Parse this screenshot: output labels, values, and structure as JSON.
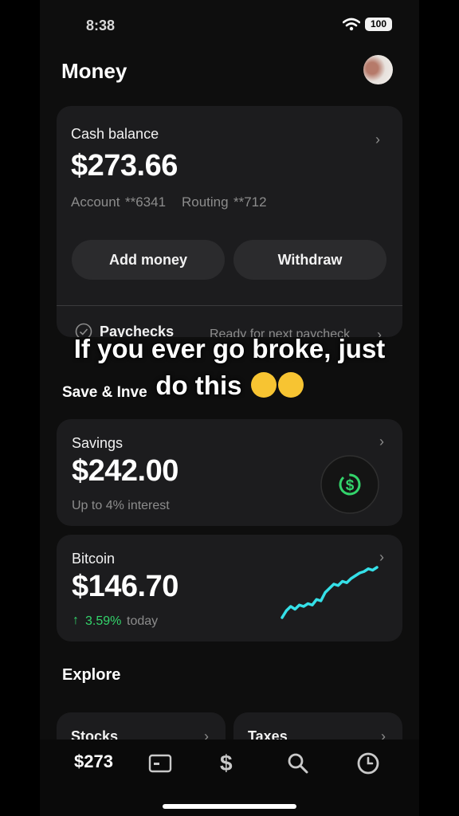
{
  "status_bar": {
    "time": "8:38",
    "battery": "100"
  },
  "header": {
    "title": "Money"
  },
  "cash_card": {
    "label": "Cash balance",
    "balance": "$273.66",
    "account_label": "Account",
    "account_masked": "**6341",
    "routing_label": "Routing",
    "routing_masked": "**712",
    "add_money": "Add money",
    "withdraw": "Withdraw",
    "paychecks_label": "Paychecks",
    "paychecks_status": "Ready for next paycheck"
  },
  "save_invest": {
    "section_title": "Save & Inve"
  },
  "savings_card": {
    "label": "Savings",
    "balance": "$242.00",
    "subtitle": "Up to 4% interest"
  },
  "bitcoin_card": {
    "label": "Bitcoin",
    "balance": "$146.70",
    "change": "3.59%",
    "period": "today",
    "change_color": "#33d46b",
    "sparkline_color": "#35e0e8"
  },
  "explore": {
    "section_title": "Explore",
    "tiles": [
      "Stocks",
      "Taxes"
    ]
  },
  "overlay_caption": {
    "line1": "If you ever go broke, just",
    "line2": "do this"
  },
  "tab_bar": {
    "balance_tab": "$273"
  },
  "chart_data": {
    "type": "line",
    "series": [
      {
        "values": [
          1,
          6,
          9,
          7,
          10,
          9,
          11,
          10,
          14,
          13,
          19,
          22,
          25,
          24,
          27,
          26,
          29,
          31,
          33,
          34,
          36,
          35,
          37
        ]
      }
    ]
  }
}
